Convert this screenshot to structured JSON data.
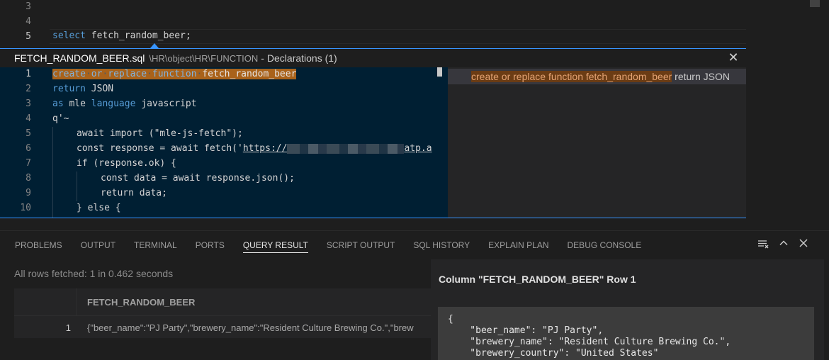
{
  "top_editor": {
    "line_numbers": [
      "3",
      "4",
      "5"
    ],
    "line5": {
      "keyword": "select",
      "rest": " fetch_random_beer;"
    }
  },
  "peek": {
    "file_name": "FETCH_RANDOM_BEER.sql",
    "path": "\\HR\\object\\HR\\FUNCTION",
    "separator": "-",
    "declarations": "Declarations (1)",
    "close_icon": "close-icon",
    "line_numbers": [
      "1",
      "2",
      "3",
      "4",
      "5",
      "6",
      "7",
      "8",
      "9",
      "10"
    ],
    "code": {
      "l1_kw1": "create",
      "l1_kw2": "or",
      "l1_kw3": "replace",
      "l1_kw4": "function",
      "l1_name": "fetch_random_beer",
      "l2_kw": "return",
      "l2_rest": " JSON",
      "l3_kw": "as",
      "l3_mid": " mle ",
      "l3_kw2": "language",
      "l3_rest": " javascript",
      "l4": "q'~",
      "l5": "await import (\"mle-js-fetch\");",
      "l6_pre": "const response = await fetch('",
      "l6_link": "https://",
      "l6_post": "atp.a",
      "l7": "if (response.ok) {",
      "l8": "const data = await response.json();",
      "l9": "return data;",
      "l10": "} else {"
    },
    "reference": {
      "highlight": "create or replace function fetch_random_beer",
      "rest": " return JSON"
    }
  },
  "panel": {
    "tabs": [
      "PROBLEMS",
      "OUTPUT",
      "TERMINAL",
      "PORTS",
      "QUERY RESULT",
      "SCRIPT OUTPUT",
      "SQL HISTORY",
      "EXPLAIN PLAN",
      "DEBUG CONSOLE"
    ],
    "active_tab": "QUERY RESULT",
    "icons": [
      "clear-list-icon",
      "chevron-up-icon",
      "close-icon"
    ],
    "status": "All rows fetched: 1 in 0.462 seconds",
    "grid": {
      "column": "FETCH_RANDOM_BEER",
      "rows": [
        {
          "num": "1",
          "value": "{\"beer_name\":\"PJ Party\",\"brewery_name\":\"Resident Culture Brewing Co.\",\"brew"
        }
      ]
    },
    "detail": {
      "title": "Column \"FETCH_RANDOM_BEER\" Row 1",
      "json_lines": [
        "{",
        "    \"beer_name\": \"PJ Party\",",
        "    \"brewery_name\": \"Resident Culture Brewing Co.\",",
        "    \"brewery_country\": \"United States\""
      ]
    }
  }
}
